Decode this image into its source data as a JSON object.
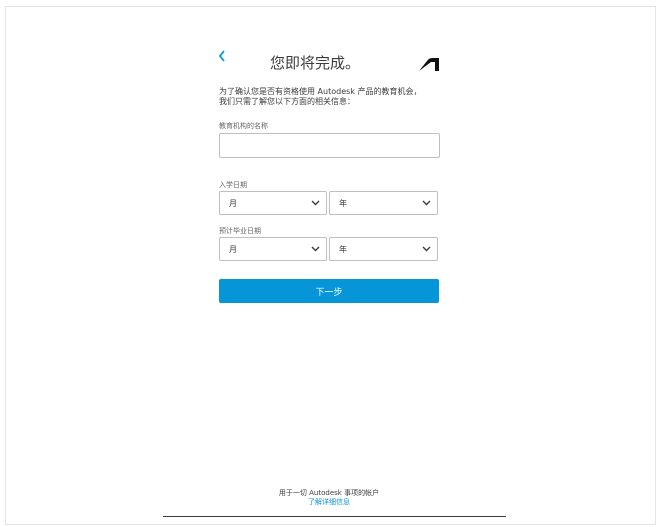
{
  "header": {
    "back_icon": "chevron-left-icon",
    "title": "您即将完成。",
    "logo": "autodesk-logo"
  },
  "intro": {
    "line1": "为了确认您是否有资格使用 Autodesk 产品的教育机会，",
    "line2": "我们只需了解您以下方面的相关信息："
  },
  "form": {
    "institution": {
      "label": "教育机构的名称",
      "value": "",
      "placeholder": ""
    },
    "enrollment": {
      "label": "入学日期",
      "month": "月",
      "year": "年"
    },
    "graduation": {
      "label": "预计毕业日期",
      "month": "月",
      "year": "年"
    },
    "next_label": "下一步"
  },
  "footer": {
    "text": "用于一切 Autodesk 事项的帐户",
    "link": "了解详细信息"
  },
  "colors": {
    "accent": "#0696d7",
    "text": "#3c3c3c",
    "border": "#bfbfbf"
  }
}
